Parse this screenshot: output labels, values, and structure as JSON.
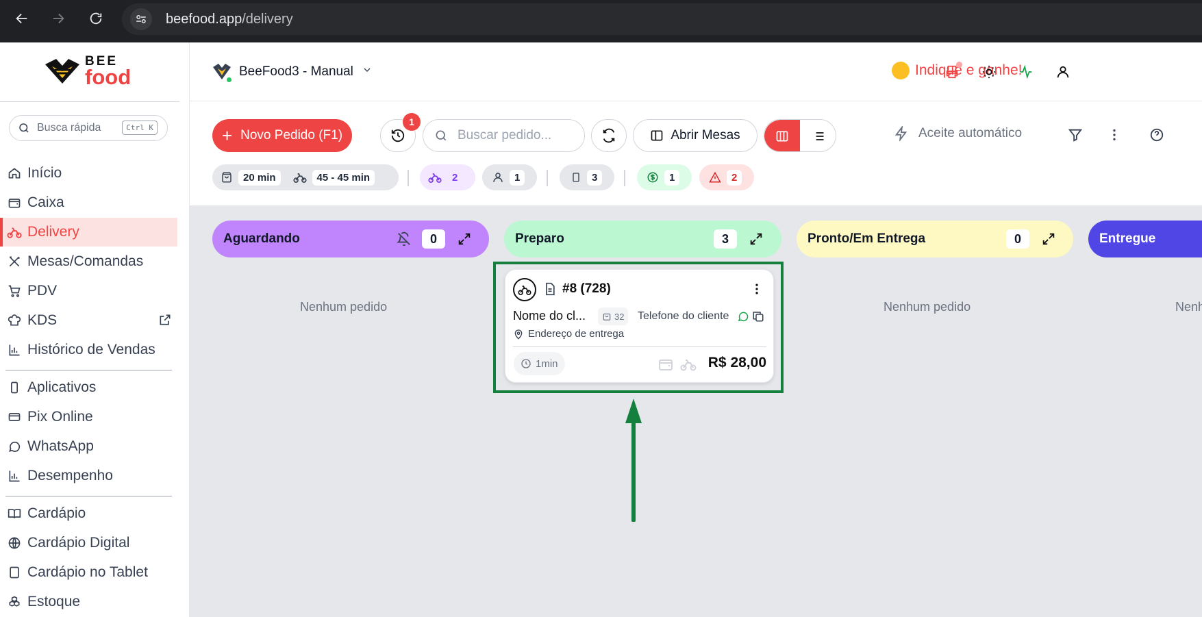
{
  "browser": {
    "url_host": "beefood.app",
    "url_path": "/delivery"
  },
  "logo": {
    "line1": "BEE",
    "line2": "food"
  },
  "quick_search": {
    "placeholder": "Busca rápida",
    "shortcut": "Ctrl K"
  },
  "sidebar": {
    "items": [
      {
        "label": "Início",
        "icon": "home-icon"
      },
      {
        "label": "Caixa",
        "icon": "wallet-icon"
      },
      {
        "label": "Delivery",
        "icon": "bike-icon",
        "active": true
      },
      {
        "label": "Mesas/Comandas",
        "icon": "utensils-icon"
      },
      {
        "label": "PDV",
        "icon": "cart-icon"
      },
      {
        "label": "KDS",
        "icon": "chef-hat-icon"
      },
      {
        "label": "Histórico de Vendas",
        "icon": "bar-chart-icon"
      },
      {
        "label": "Aplicativos",
        "icon": "phone-icon"
      },
      {
        "label": "Pix Online",
        "icon": "card-icon"
      },
      {
        "label": "WhatsApp",
        "icon": "chat-icon"
      },
      {
        "label": "Desempenho",
        "icon": "bar-chart-icon"
      },
      {
        "label": "Cardápio",
        "icon": "book-icon"
      },
      {
        "label": "Cardápio Digital",
        "icon": "globe-icon"
      },
      {
        "label": "Cardápio no Tablet",
        "icon": "tablet-icon"
      },
      {
        "label": "Estoque",
        "icon": "boxes-icon"
      }
    ]
  },
  "header": {
    "store_name": "BeeFood3 - Manual",
    "refer_label": "Indique e ganhe!"
  },
  "toolbar": {
    "new_order_label": "Novo Pedido (F1)",
    "history_badge": "1",
    "search_placeholder": "Buscar pedido...",
    "open_tables_label": "Abrir Mesas",
    "auto_accept_label": "Aceite automático"
  },
  "stats": {
    "prep_time": "20 min",
    "delivery_time": "45 - 45 min",
    "delivery_count": "2",
    "pickup_count": "1",
    "app_count": "3",
    "paid_count": "1",
    "alert_count": "2"
  },
  "columns": [
    {
      "title": "Aguardando",
      "count": "0",
      "empty_text": "Nenhum pedido",
      "color": "#c084fc"
    },
    {
      "title": "Preparo",
      "count": "3",
      "color": "#bbf7d0"
    },
    {
      "title": "Pronto/Em Entrega",
      "count": "0",
      "empty_text": "Nenhum pedido",
      "color": "#fef9c3"
    },
    {
      "title": "Entregue",
      "empty_text": "Nenhum pedido",
      "color": "#4f46e5"
    }
  ],
  "order_card": {
    "number": "#8 (728)",
    "customer": "Nome do cl...",
    "bag_count": "32",
    "phone": "Telefone do cliente",
    "address": "Endereço de entrega",
    "elapsed": "1min",
    "total": "R$ 28,00"
  },
  "colors": {
    "brand": "#ef4444",
    "highlight": "#15803d"
  }
}
